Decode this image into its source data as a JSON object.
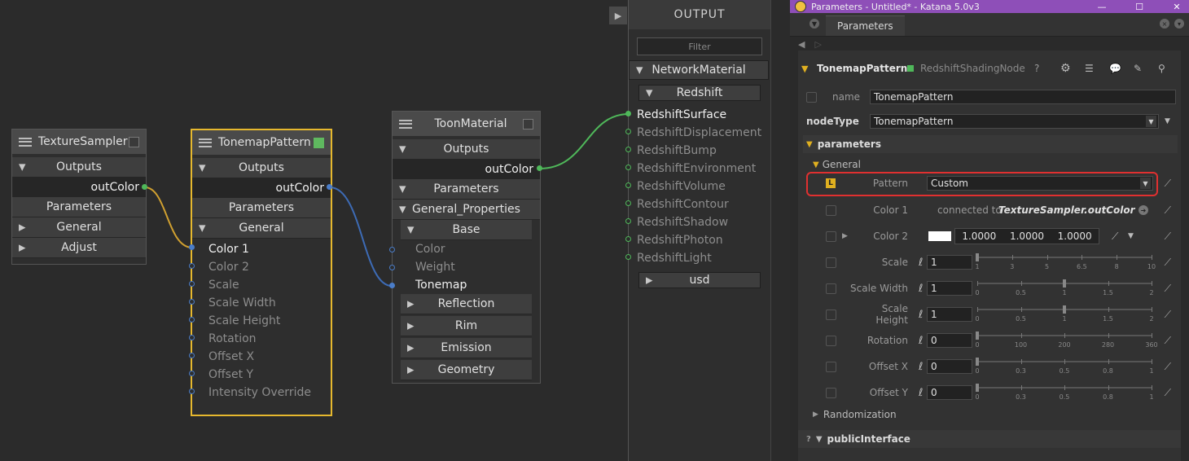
{
  "graph": {
    "nodes": {
      "texture_sampler": {
        "title": "TextureSampler",
        "outputs": "Outputs",
        "out_port": "outColor",
        "parameters": "Parameters",
        "groups": [
          "General",
          "Adjust"
        ]
      },
      "tonemap_pattern": {
        "title": "TonemapPattern",
        "outputs": "Outputs",
        "out_port": "outColor",
        "parameters": "Parameters",
        "general": "General",
        "inputs": [
          "Color 1",
          "Color 2",
          "Scale",
          "Scale Width",
          "Scale Height",
          "Rotation",
          "Offset X",
          "Offset Y",
          "Intensity Override"
        ]
      },
      "toon_material": {
        "title": "ToonMaterial",
        "outputs": "Outputs",
        "out_port": "outColor",
        "parameters": "Parameters",
        "general_props": "General_Properties",
        "base": "Base",
        "inputs": [
          "Color",
          "Weight",
          "Tonemap"
        ],
        "subgroups": [
          "Reflection",
          "Rim",
          "Emission",
          "Geometry"
        ]
      }
    }
  },
  "output": {
    "title": "OUTPUT",
    "filter_placeholder": "Filter",
    "network_material": "NetworkMaterial",
    "redshift": "Redshift",
    "ports": [
      "RedshiftSurface",
      "RedshiftDisplacement",
      "RedshiftBump",
      "RedshiftEnvironment",
      "RedshiftVolume",
      "RedshiftContour",
      "RedshiftShadow",
      "RedshiftPhoton",
      "RedshiftLight"
    ],
    "usd": "usd"
  },
  "params": {
    "window_title": "Parameters - Untitled* - Katana 5.0v3",
    "tab": "Parameters",
    "node_name": "TonemapPattern",
    "node_type_label": "RedshiftShadingNode",
    "name_label": "name",
    "name_value": "TonemapPattern",
    "nodetype_label": "nodeType",
    "nodetype_value": "TonemapPattern",
    "parameters_label": "parameters",
    "general_label": "General",
    "pattern": {
      "label": "Pattern",
      "value": "Custom"
    },
    "color1": {
      "label": "Color 1",
      "connected_prefix": "connected to",
      "connected_target": "TextureSampler.outColor"
    },
    "color2": {
      "label": "Color 2",
      "values": [
        "1.0000",
        "1.0000",
        "1.0000"
      ],
      "swatch": "#ffffff"
    },
    "sliders": [
      {
        "label": "Scale",
        "value": "1",
        "ticks": [
          "1",
          "3",
          "5",
          "6.5",
          "8",
          "10"
        ],
        "level": 0.0
      },
      {
        "label": "Scale Width",
        "value": "1",
        "ticks": [
          "0",
          "0.5",
          "1",
          "1.5",
          "2"
        ],
        "level": 0.5
      },
      {
        "label": "Scale Height",
        "value": "1",
        "ticks": [
          "0",
          "0.5",
          "1",
          "1.5",
          "2"
        ],
        "level": 0.5
      },
      {
        "label": "Rotation",
        "value": "0",
        "ticks": [
          "0",
          "100",
          "200",
          "280",
          "360"
        ],
        "level": 0.0
      },
      {
        "label": "Offset X",
        "value": "0",
        "ticks": [
          "0",
          "0.3",
          "0.5",
          "0.8",
          "1"
        ],
        "level": 0.0
      },
      {
        "label": "Offset Y",
        "value": "0",
        "ticks": [
          "0",
          "0.3",
          "0.5",
          "0.8",
          "1"
        ],
        "level": 0.0
      }
    ],
    "randomization": "Randomization",
    "public_interface": "publicInterface",
    "highlight_color": "#e03030",
    "accent_purple": "#8e4fb8",
    "selected_node_color": "#e6b82e"
  }
}
